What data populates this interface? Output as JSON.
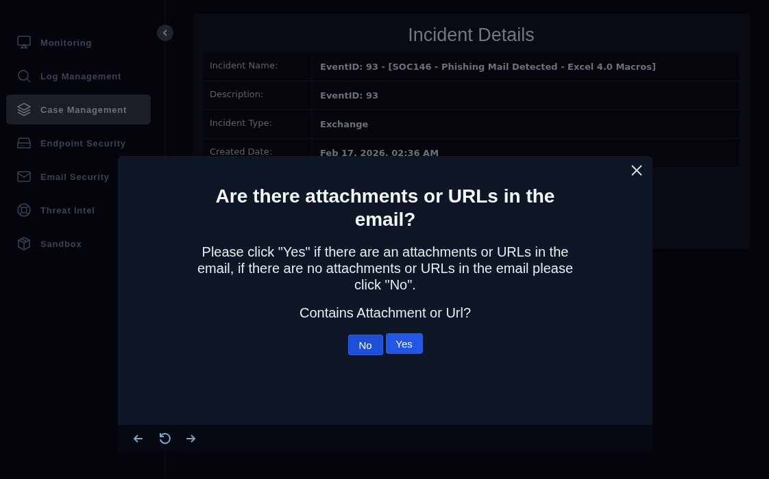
{
  "sidebar": {
    "items": [
      {
        "label": "Monitoring",
        "selected": false
      },
      {
        "label": "Log Management",
        "selected": false
      },
      {
        "label": "Case Management",
        "selected": true
      },
      {
        "label": "Endpoint Security",
        "selected": false
      },
      {
        "label": "Email Security",
        "selected": false
      },
      {
        "label": "Threat Intel",
        "selected": false
      },
      {
        "label": "Sandbox",
        "selected": false
      }
    ]
  },
  "incident": {
    "title": "Incident Details",
    "rows": [
      {
        "label": "Incident Name:",
        "value": "EventID: 93 - [SOC146 - Phishing Mail Detected - Excel 4.0 Macros]"
      },
      {
        "label": "Description:",
        "value": "EventID: 93"
      },
      {
        "label": "Incident Type:",
        "value": "Exchange"
      },
      {
        "label": "Created Date:",
        "value": "Feb 17, 2026, 02:36 AM"
      }
    ]
  },
  "dialog": {
    "title": "Are there attachments or URLs in the email?",
    "message": "Please click \"Yes\" if there are an attachments or URLs in the email, if there are no attachments or URLs in the email please click \"No\".",
    "question": "Contains Attachment or Url?",
    "buttons": [
      {
        "label": "No",
        "hovered": false
      },
      {
        "label": "Yes",
        "hovered": true
      }
    ]
  }
}
